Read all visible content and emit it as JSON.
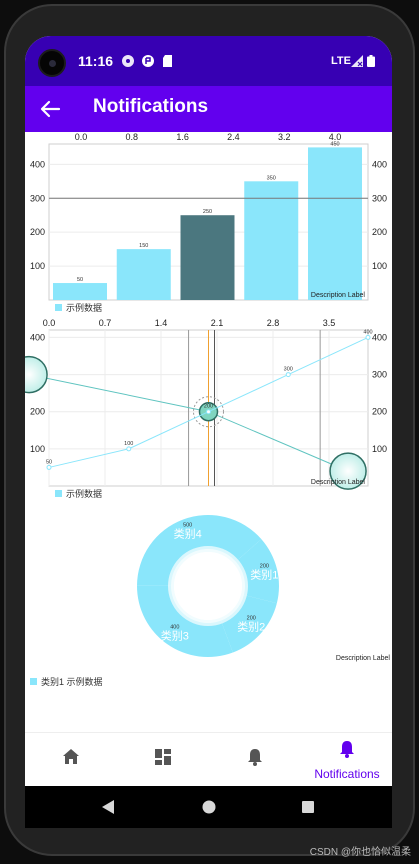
{
  "status_bar": {
    "time": "11:16",
    "network": "LTE"
  },
  "app_bar": {
    "title": "Notifications"
  },
  "bar_chart": {
    "type": "bar",
    "top_ticks": [
      "0.0",
      "0.8",
      "1.6",
      "2.4",
      "3.2",
      "4.0"
    ],
    "y_ticks": [
      "100",
      "200",
      "300",
      "400"
    ],
    "y_range": [
      0,
      460
    ],
    "categories": [
      0,
      1,
      2,
      3,
      4
    ],
    "values": [
      50,
      150,
      250,
      350,
      450
    ],
    "value_labels": [
      "50",
      "150",
      "250",
      "350",
      "450"
    ],
    "highlight_index": 2,
    "limit_line": 300,
    "legend": "示例数据",
    "description": "Description Label",
    "bar_color": "#8ae6fb",
    "highlight_color": "#4b777f"
  },
  "line_chart": {
    "type": "line",
    "top_ticks": [
      "0.0",
      "0.7",
      "1.4",
      "2.1",
      "2.8",
      "3.5"
    ],
    "y_ticks": [
      "100",
      "200",
      "300",
      "400"
    ],
    "y_range": [
      0,
      420
    ],
    "x_range": [
      0,
      4
    ],
    "x": [
      0,
      1,
      2,
      3,
      4
    ],
    "y": [
      50,
      100,
      200,
      300,
      400
    ],
    "value_labels": [
      "50",
      "100",
      "200",
      "300",
      "400"
    ],
    "bubble_series": [
      {
        "x": -0.25,
        "y": 300
      },
      {
        "x": 2,
        "y": 200
      },
      {
        "x": 3.75,
        "y": 40
      }
    ],
    "legend": "示例数据",
    "description": "Description Label",
    "line_color": "#8ae6fb"
  },
  "pie_chart": {
    "type": "pie",
    "slices": [
      {
        "label": "类别1",
        "value": 200,
        "value_label": "200"
      },
      {
        "label": "类别2",
        "value": 200,
        "value_label": "200"
      },
      {
        "label": "类别3",
        "value": 400,
        "value_label": "400"
      },
      {
        "label": "类别4",
        "value": 500,
        "value_label": "500"
      }
    ],
    "legend": "类别1  示例数据",
    "description": "Description Label",
    "color": "#8ae6fb"
  },
  "bottom_nav": {
    "notifications_label": "Notifications"
  },
  "watermark": "CSDN @你也恰似温柔",
  "colors": {
    "primary": "#6200ee",
    "primary_dark": "#3700b3",
    "accent": "#8ae6fb"
  }
}
